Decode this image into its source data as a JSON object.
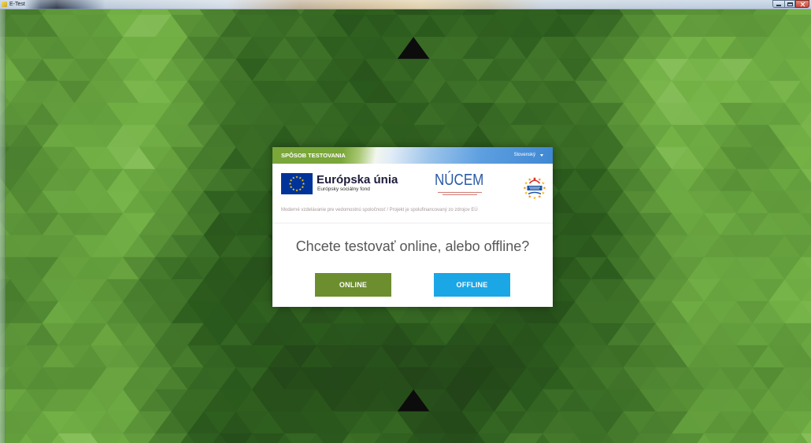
{
  "window": {
    "title": "E-Test",
    "icons": {
      "app": "app-icon",
      "minimize": "minimize-icon",
      "maximize": "maximize-icon",
      "close": "close-icon"
    }
  },
  "background": {
    "dark_green": "#2b5a1d",
    "light_green": "#74b246",
    "highlight_green": "#a9d57f",
    "black": "#0c0c0c"
  },
  "dialog": {
    "header": {
      "title": "SPÔSOB TESTOVANIA",
      "language": "Slovenský",
      "language_icon": "chevron-down-icon"
    },
    "logos": {
      "eu_title": "Európska únia",
      "eu_subtitle": "Európsky sociálny fond",
      "nucem": "NÚCEM",
      "icons": [
        "eu-flag-icon",
        "nucem-logo-icon",
        "quality-stars-logo-icon"
      ]
    },
    "tagline": "Moderné vzdelávanie pre vedomostnú spoločnosť / Projekt je spolufinancovaný zo zdrojov EÚ",
    "question": "Chcete testovať online, alebo offline?",
    "buttons": {
      "online": "ONLINE",
      "offline": "OFFLINE"
    }
  },
  "colors": {
    "header_green": "#7aa63a",
    "header_blue": "#3f87d3",
    "online_button": "#6d8e2f",
    "offline_button": "#1ba6e6",
    "question_text": "#575757",
    "close_button": "#c9463b",
    "nucem_blue": "#2a59a6",
    "eu_blue": "#003399",
    "eu_yellow": "#ffcc00",
    "logo_gold": "#f0be1a",
    "logo_orange": "#e8932a",
    "logo_red": "#d42a2a",
    "logo_blue": "#1d56a5"
  }
}
